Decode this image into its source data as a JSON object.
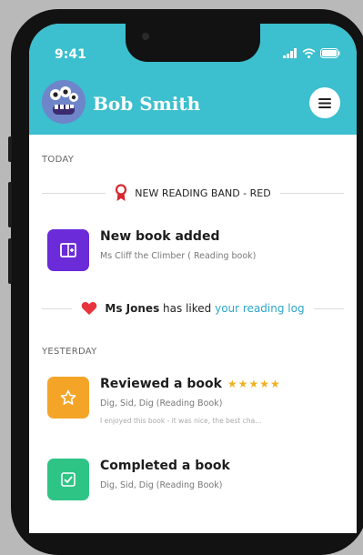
{
  "status_bar": {
    "time": "9:41"
  },
  "header": {
    "username": "Bob Smith"
  },
  "feed": {
    "today_label": "TODAY",
    "reading_band": "NEW READING BAND - RED",
    "new_book": {
      "title": "New book added",
      "subtitle": "Ms Cliff the Climber ( Reading book)"
    },
    "like": {
      "person": "Ms Jones",
      "action": "has liked",
      "link": "your reading log"
    },
    "yesterday_label": "YESTERDAY",
    "reviewed": {
      "title": "Reviewed a book",
      "stars": "★★★★★",
      "rating": 5,
      "subtitle": "Dig, Sid, Dig (Reading Book)",
      "note": "I enjoyed this book - it was nice, the best cha..."
    },
    "completed": {
      "title": "Completed a book",
      "subtitle": "Dig, Sid, Dig (Reading Book)"
    }
  },
  "colors": {
    "header": "#3cbfce",
    "new_book_icon": "#6b2bd9",
    "review_icon": "#f4a528",
    "completed_icon": "#2ec486",
    "heart": "#e8333d",
    "band_ribbon": "#d8262e",
    "stars": "#f2b01e",
    "link": "#2ea6c9"
  },
  "icons": {
    "menu": "hamburger-menu-icon",
    "ribbon": "award-ribbon-icon",
    "book": "book-plus-icon",
    "heart": "heart-icon",
    "star": "star-icon",
    "check": "checkmark-icon"
  }
}
